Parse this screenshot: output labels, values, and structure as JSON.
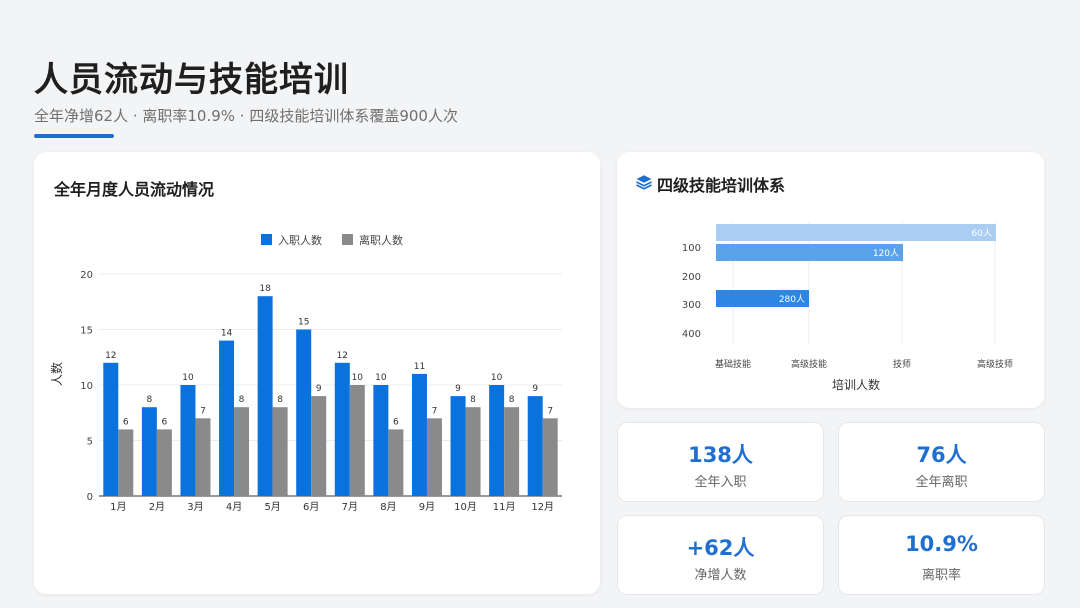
{
  "header": {
    "title": "人员流动与技能培训",
    "subtitle": "全年净增62人 · 离职率10.9% · 四级技能培训体系覆盖900人次"
  },
  "monthly_card": {
    "title": "全年月度人员流动情况"
  },
  "training_card": {
    "title": "四级技能培训体系",
    "icon": "layers-icon"
  },
  "stats": [
    {
      "value": "138人",
      "label": "全年入职"
    },
    {
      "value": "76人",
      "label": "全年离职"
    },
    {
      "value": "+62人",
      "label": "净增人数"
    },
    {
      "value": "10.9%",
      "label": "离职率"
    }
  ],
  "colors": {
    "primary": "#1f6fd0",
    "bar_blue": "#0a72dd",
    "bar_gray": "#8a8a8a",
    "hbar_light": "#a9cdf3",
    "hbar_mid": "#5aa2ea",
    "hbar_dark": "#2b86e6"
  },
  "chart_data": [
    {
      "type": "bar",
      "categories": [
        "1月",
        "2月",
        "3月",
        "4月",
        "5月",
        "6月",
        "7月",
        "8月",
        "9月",
        "10月",
        "11月",
        "12月"
      ],
      "series": [
        {
          "name": "入职人数",
          "values": [
            12,
            8,
            10,
            14,
            18,
            15,
            12,
            10,
            11,
            9,
            10,
            9
          ],
          "color": "#0a72dd"
        },
        {
          "name": "离职人数",
          "values": [
            6,
            6,
            7,
            8,
            8,
            9,
            10,
            6,
            7,
            8,
            8,
            7
          ],
          "color": "#8a8a8a"
        }
      ],
      "ylabel": "人数",
      "ylim": [
        0,
        20
      ],
      "yticks": [
        0,
        5,
        10,
        15,
        20
      ],
      "legend": "top-center",
      "grid": true
    },
    {
      "type": "bar",
      "orientation": "horizontal",
      "categories": [
        "基础技能",
        "高级技能",
        "技师",
        "高级技师"
      ],
      "values": [
        60,
        120,
        280,
        null
      ],
      "value_labels": [
        "60人",
        "120人",
        "280人"
      ],
      "xlabel": "培训人数",
      "xticks": [
        "基础技能",
        "高级技能",
        "技师",
        "高级技师"
      ],
      "yticks": [
        100,
        200,
        300,
        400
      ],
      "grid": true
    }
  ]
}
